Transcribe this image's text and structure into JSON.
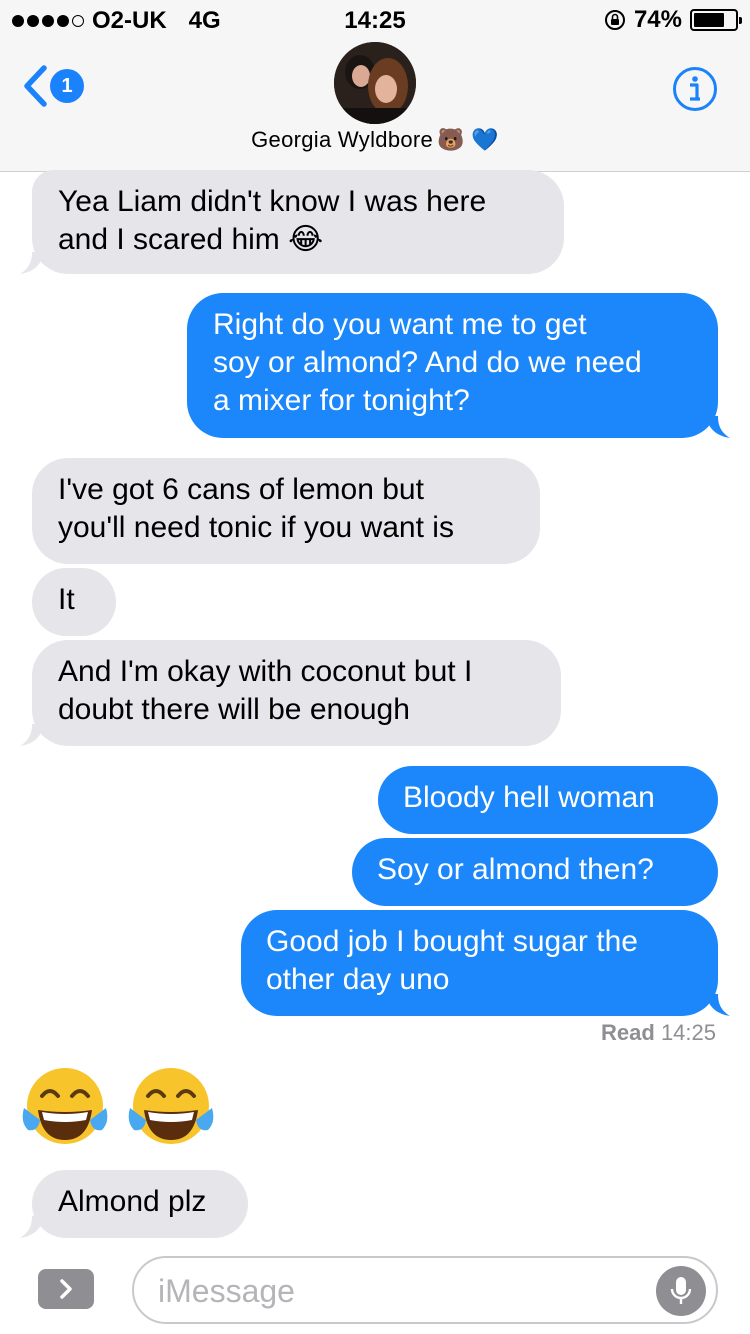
{
  "status_bar": {
    "carrier": "O2-UK",
    "network": "4G",
    "time": "14:25",
    "battery_percent": "74%",
    "battery_level": 0.74,
    "signal_bars": 4
  },
  "header": {
    "back_badge": "1",
    "contact_name": "Georgia Wyldbore",
    "name_emojis": "🐻 💙"
  },
  "messages": [
    {
      "direction": "in",
      "text_lines": [
        "Yea Liam didn't know I was here",
        "and I scared him"
      ],
      "emoji": "😂"
    },
    {
      "direction": "out",
      "text_lines": [
        "Right do you want me to get",
        "soy or almond? And do we need",
        "a mixer for tonight?"
      ]
    },
    {
      "direction": "in",
      "text_lines": [
        "I've got 6 cans of lemon but",
        "you'll need tonic if you want is"
      ]
    },
    {
      "direction": "in",
      "text_lines": [
        "It"
      ]
    },
    {
      "direction": "in",
      "text_lines": [
        "And I'm okay with coconut but I",
        "doubt there will be enough"
      ]
    },
    {
      "direction": "out",
      "text_lines": [
        "Bloody hell woman"
      ]
    },
    {
      "direction": "out",
      "text_lines": [
        "Soy or almond then?"
      ]
    },
    {
      "direction": "out",
      "text_lines": [
        "Good job I bought sugar the",
        "other day uno"
      ]
    },
    {
      "direction": "in",
      "emoji_only": "😂😂"
    },
    {
      "direction": "in",
      "text_lines": [
        "Almond plz"
      ]
    }
  ],
  "read_receipt": {
    "label": "Read",
    "time": "14:25"
  },
  "input": {
    "placeholder": "iMessage"
  },
  "colors": {
    "outgoing": "#1b87fa",
    "incoming": "#e5e5ea",
    "accent": "#1a82fb"
  }
}
